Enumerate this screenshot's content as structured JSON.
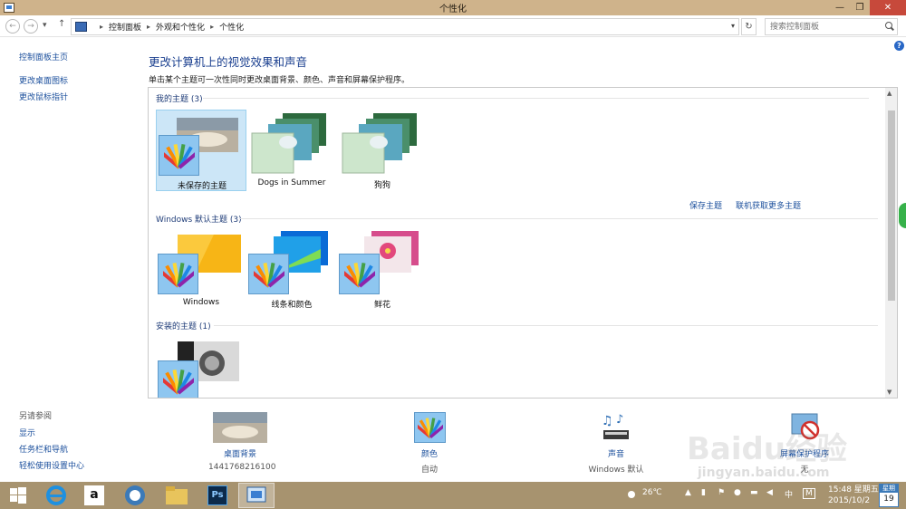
{
  "window": {
    "title": "个性化"
  },
  "address": {
    "crumbs": [
      "控制面板",
      "外观和个性化",
      "个性化"
    ],
    "search_placeholder": "搜索控制面板"
  },
  "left": {
    "home": "控制面板主页",
    "links": [
      "更改桌面图标",
      "更改鼠标指针"
    ],
    "see_also": "另请参阅",
    "see_also_links": [
      "显示",
      "任务栏和导航",
      "轻松使用设置中心"
    ]
  },
  "main": {
    "heading": "更改计算机上的视觉效果和声音",
    "subheading": "单击某个主题可一次性同时更改桌面背景、颜色、声音和屏幕保护程序。",
    "groups": [
      {
        "title": "我的主题 (3)",
        "themes": [
          "未保存的主题",
          "Dogs in Summer",
          "狗狗"
        ]
      },
      {
        "title": "Windows 默认主题 (3)",
        "themes": [
          "Windows",
          "线条和颜色",
          "鲜花"
        ]
      },
      {
        "title": "安装的主题 (1)",
        "themes": [
          ""
        ]
      }
    ],
    "save_theme": "保存主题",
    "get_more": "联机获取更多主题"
  },
  "bottom": [
    {
      "label": "桌面背景",
      "value": "1441768216100",
      "icon": "desktop-background-icon"
    },
    {
      "label": "颜色",
      "value": "自动",
      "icon": "color-icon"
    },
    {
      "label": "声音",
      "value": "Windows 默认",
      "icon": "sound-icon"
    },
    {
      "label": "屏幕保护程序",
      "value": "无",
      "icon": "screensaver-icon"
    }
  ],
  "taskbar": {
    "temp": "26℃",
    "ime": "中",
    "time": "15:48 星期五",
    "date": "2015/10/2",
    "cal_month": "星期",
    "cal_day": "19"
  },
  "watermark": {
    "brand": "Baidu经验",
    "url": "jingyan.baidu.com"
  },
  "colors": {
    "titlebar": "#cfb38b",
    "taskbar": "#a7936f",
    "link": "#1b4f9c",
    "heading": "#1a3f8f",
    "selected": "#cce6f7"
  }
}
